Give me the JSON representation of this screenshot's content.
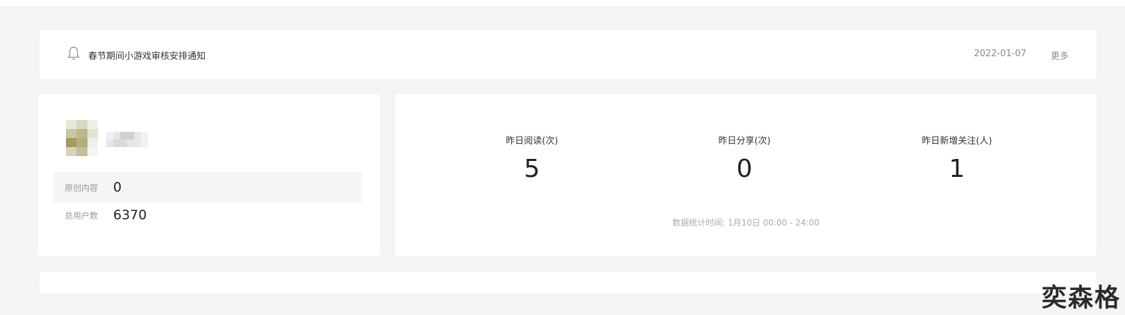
{
  "notice": {
    "title": "春节期间小游戏审核安排通知",
    "date": "2022-01-07",
    "more_label": "更多",
    "icon": "bell-icon"
  },
  "account": {
    "stats": [
      {
        "label": "原创内容",
        "value": "0"
      },
      {
        "label": "总用户数",
        "value": "6370"
      }
    ]
  },
  "metrics": [
    {
      "label": "昨日阅读(次)",
      "value": "5"
    },
    {
      "label": "昨日分享(次)",
      "value": "0"
    },
    {
      "label": "昨日新增关注(人)",
      "value": "1"
    }
  ],
  "stats_note": "数据统计时间: 1月10日 00:00 - 24:00",
  "watermark": "奕森格"
}
